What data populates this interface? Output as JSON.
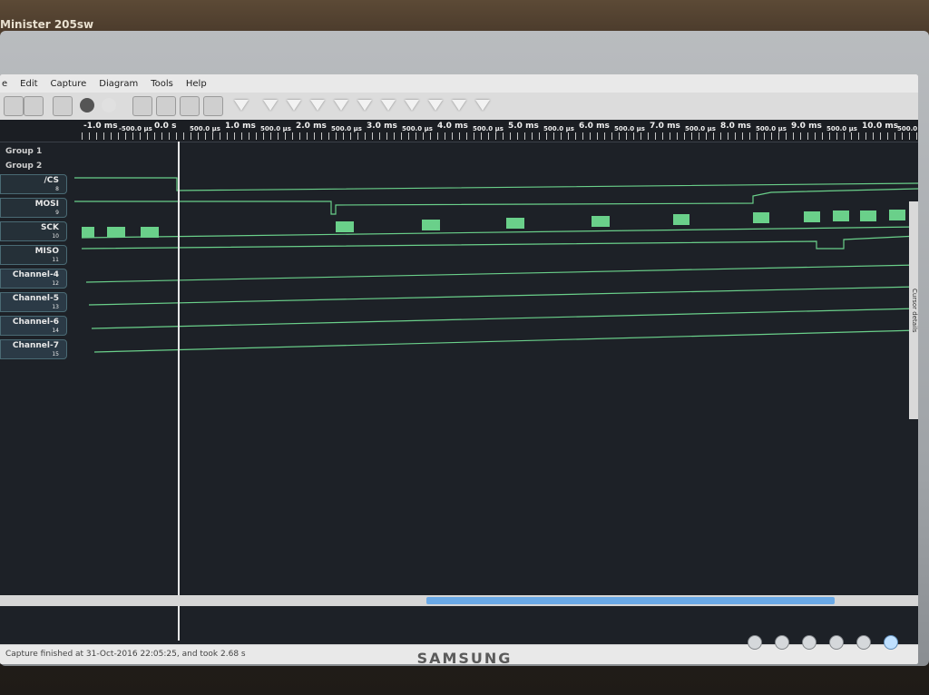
{
  "window": {
    "title": "Minister 205sw"
  },
  "menubar": {
    "items": [
      "e",
      "Edit",
      "Capture",
      "Diagram",
      "Tools",
      "Help"
    ]
  },
  "toolbar": {
    "icons": [
      "monitor-icon",
      "download-icon",
      "save-icon",
      "record-icon",
      "refresh-icon",
      "zoom-in-icon",
      "zoom-out-icon",
      "zoom-fit-icon",
      "zoom-reset-icon",
      "home-icon",
      "marker-1-icon",
      "marker-2-icon",
      "marker-3-icon",
      "marker-4-icon",
      "marker-5-icon",
      "marker-6-icon",
      "marker-7-icon",
      "marker-8-icon",
      "marker-9-icon",
      "marker-10-icon"
    ]
  },
  "timeline": {
    "labels": [
      {
        "text": "-1.0 ms",
        "size": "big"
      },
      {
        "text": "-500.0 µs",
        "size": "small"
      },
      {
        "text": "0.0 s",
        "size": "big"
      },
      {
        "text": "500.0 µs",
        "size": "small"
      },
      {
        "text": "1.0 ms",
        "size": "big"
      },
      {
        "text": "500.0 µs",
        "size": "small"
      },
      {
        "text": "2.0 ms",
        "size": "big"
      },
      {
        "text": "500.0 µs",
        "size": "small"
      },
      {
        "text": "3.0 ms",
        "size": "big"
      },
      {
        "text": "500.0 µs",
        "size": "small"
      },
      {
        "text": "4.0 ms",
        "size": "big"
      },
      {
        "text": "500.0 µs",
        "size": "small"
      },
      {
        "text": "5.0 ms",
        "size": "big"
      },
      {
        "text": "500.0 µs",
        "size": "small"
      },
      {
        "text": "6.0 ms",
        "size": "big"
      },
      {
        "text": "500.0 µs",
        "size": "small"
      },
      {
        "text": "7.0 ms",
        "size": "big"
      },
      {
        "text": "500.0 µs",
        "size": "small"
      },
      {
        "text": "8.0 ms",
        "size": "big"
      },
      {
        "text": "500.0 µs",
        "size": "small"
      },
      {
        "text": "9.0 ms",
        "size": "big"
      },
      {
        "text": "500.0 µs",
        "size": "small"
      },
      {
        "text": "10.0 ms",
        "size": "big"
      },
      {
        "text": "500.0 µs",
        "size": "small"
      }
    ]
  },
  "groups": {
    "group1": "Group 1",
    "group2": "Group 2"
  },
  "channels": [
    {
      "name": "/CS",
      "num": "8"
    },
    {
      "name": "MOSI",
      "num": "9"
    },
    {
      "name": "SCK",
      "num": "10"
    },
    {
      "name": "MISO",
      "num": "11"
    },
    {
      "name": "Channel-4",
      "num": "12"
    },
    {
      "name": "Channel-5",
      "num": "13"
    },
    {
      "name": "Channel-6",
      "num": "14"
    },
    {
      "name": "Channel-7",
      "num": "15"
    }
  ],
  "sidepanel": {
    "label": "Cursor details"
  },
  "status": {
    "text": "Capture finished at 31-Oct-2016 22:05:25, and took 2.68 s"
  },
  "monitor": {
    "brand": "SAMSUNG"
  },
  "colors": {
    "signal": "#6ad08a",
    "background": "#1d2127",
    "cursor": "#e6e6e6"
  }
}
